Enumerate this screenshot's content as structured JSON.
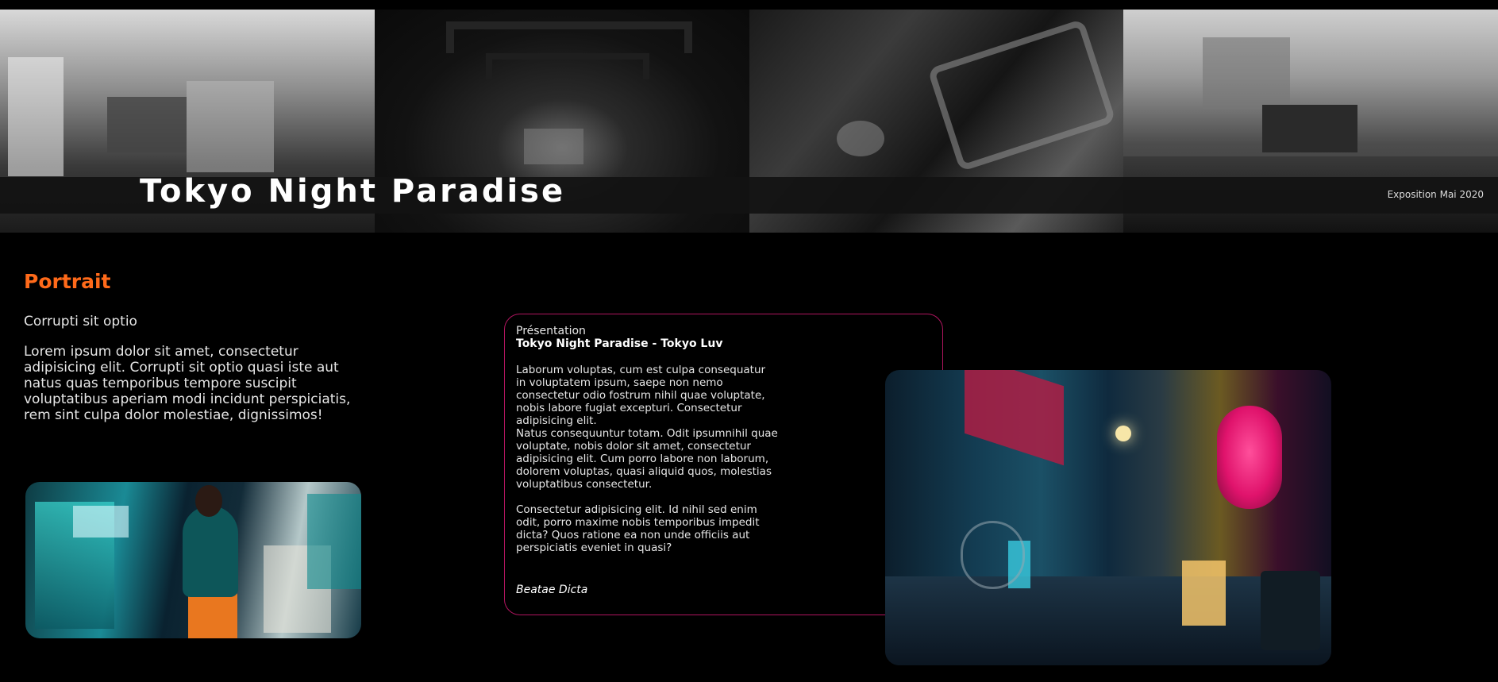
{
  "header": {
    "title": "Tokyo Night Paradise",
    "date": "Exposition Mai 2020"
  },
  "portrait": {
    "title": "Portrait",
    "subtitle": "Corrupti sit optio",
    "body": "Lorem ipsum dolor sit amet, consectetur adipisicing elit. Corrupti sit optio quasi iste aut natus quas temporibus tempore suscipit voluptatibus aperiam modi incidunt perspiciatis, rem sint culpa dolor molestiae, dignissimos!"
  },
  "presentation": {
    "label": "Présentation",
    "heading": "Tokyo Night Paradise - Tokyo Luv",
    "paragraphs": [
      "Laborum voluptas, cum est culpa consequatur in voluptatem ipsum, saepe non nemo consectetur odio fostrum nihil quae voluptate, nobis labore fugiat excepturi. Consectetur adipisicing elit.",
      "Natus consequuntur totam. Odit ipsumnihil quae voluptate, nobis dolor sit amet, consectetur adipisicing elit. Cum porro labore non laborum, dolorem voluptas, quasi aliquid quos, molestias voluptatibus consectetur.",
      "Consectetur adipisicing elit. Id nihil sed enim odit, porro maxime nobis temporibus impedit dicta? Quos ratione ea non unde officiis aut perspiciatis eveniet in quasi?"
    ],
    "signature": "Beatae Dicta"
  },
  "colors": {
    "accent": "#ff6a1a",
    "card_border": "#b0155f",
    "background": "#000000"
  }
}
